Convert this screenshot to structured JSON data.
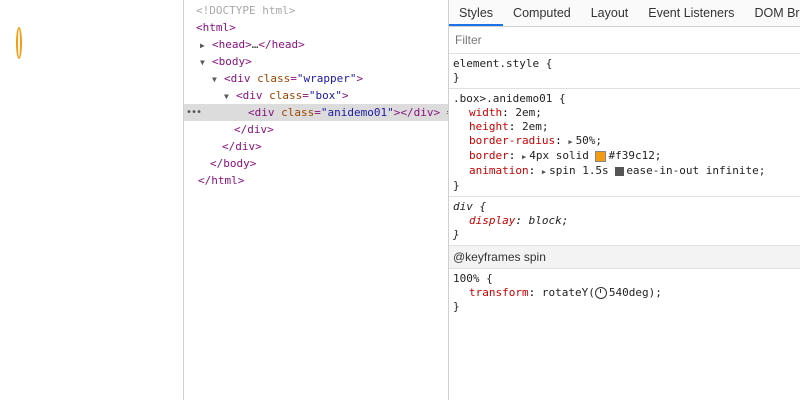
{
  "styles": {
    "tabs": [
      "Styles",
      "Computed",
      "Layout",
      "Event Listeners",
      "DOM Breakp"
    ],
    "filter_placeholder": "Filter",
    "element_style": {
      "selector": "element.style {",
      "close": "}"
    },
    "rule1": {
      "selector": ".box>.anidemo01 {",
      "decls": [
        {
          "prop": "width",
          "value": "2em;"
        },
        {
          "prop": "height",
          "value": "2em;"
        },
        {
          "prop": "border-radius",
          "value": "50%;"
        },
        {
          "prop": "border",
          "value_pre": "4px solid ",
          "value_color": "#f39c12;"
        },
        {
          "prop": "animation",
          "value_pre": "spin 1.5s ",
          "value_post": "ease-in-out infinite;"
        }
      ],
      "close": "}"
    },
    "rule2": {
      "selector": "div {",
      "prop": "display",
      "value": "block;",
      "close": "}"
    },
    "keyframes": {
      "header": "@keyframes spin",
      "selector": "100% {",
      "prop": "transform",
      "value_pre": "rotateY(",
      "value_post": "540deg);",
      "close": "}"
    },
    "colors": {
      "accent": "#1a73e8",
      "swatch": "#f39c12"
    }
  },
  "elements": {
    "lines": [
      {
        "text": "<!DOCTYPE html>"
      },
      {
        "text": "<html>"
      },
      {
        "open": "<head>",
        "ellipsis": "…",
        "close": "</head>"
      },
      {
        "text": "<body>"
      },
      {
        "tag": "<div ",
        "attr": "class",
        "eq": "=",
        "val": "\"wrapper\"",
        "end": ">"
      },
      {
        "tag": "<div ",
        "attr": "class",
        "eq": "=",
        "val": "\"box\"",
        "end": ">"
      },
      {
        "tag": "<div ",
        "attr": "class",
        "eq": "=",
        "val": "\"anidemo01\"",
        "end": "></div>",
        "suffix": " ="
      },
      {
        "text": "</div>"
      },
      {
        "text": "</div>"
      },
      {
        "text": "</body>"
      },
      {
        "text": "</html>"
      }
    ],
    "dots": "•••"
  }
}
